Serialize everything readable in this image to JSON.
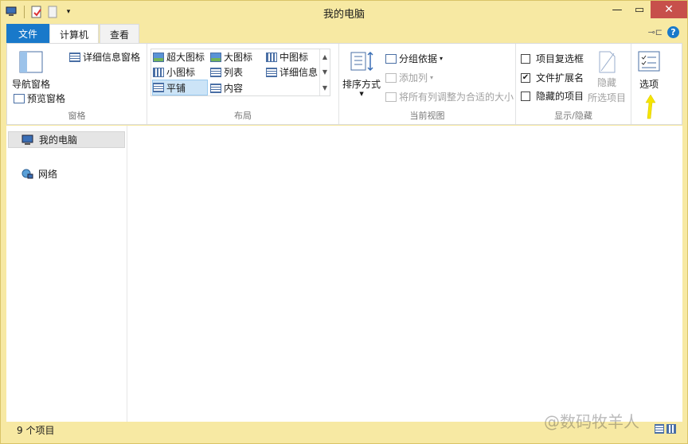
{
  "window": {
    "title": "我的电脑"
  },
  "tabs": {
    "file": "文件",
    "computer": "计算机",
    "view": "查看"
  },
  "ribbon": {
    "panes": {
      "nav_pane": "导航窗格",
      "preview_pane": "预览窗格",
      "details_pane": "详细信息窗格",
      "label": "窗格"
    },
    "layout": {
      "items": [
        "超大图标",
        "大图标",
        "中图标",
        "小图标",
        "列表",
        "详细信息",
        "平铺",
        "内容"
      ],
      "label": "布局"
    },
    "current_view": {
      "sort": "排序方式",
      "group_by": "分组依据",
      "add_column": "添加列",
      "fit_columns": "将所有列调整为合适的大小",
      "label": "当前视图"
    },
    "show_hide": {
      "item_checkboxes": "项目复选框",
      "file_extensions": "文件扩展名",
      "hidden_items": "隐藏的项目",
      "hide_selected": "隐藏",
      "hide_selected_2": "所选项目",
      "label": "显示/隐藏",
      "checked": {
        "item_checkboxes": false,
        "file_extensions": true,
        "hidden_items": false
      }
    },
    "options": "选项"
  },
  "nav": {
    "items": [
      "我的电脑",
      "网络"
    ]
  },
  "status": {
    "count": "9 个项目"
  },
  "watermark": "@数码牧羊人",
  "colors": {
    "accent": "#1979ca",
    "frame": "#f7e9a3",
    "close": "#c7504b",
    "arrow": "#f5e400"
  }
}
